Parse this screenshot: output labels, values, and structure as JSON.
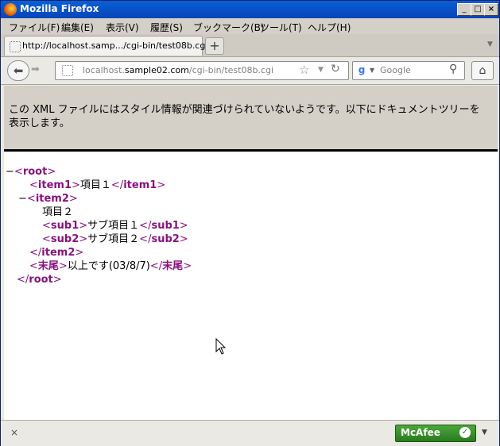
{
  "window": {
    "title": "Mozilla Firefox"
  },
  "menu": [
    "ファイル(F)",
    "編集(E)",
    "表示(V)",
    "履歴(S)",
    "ブックマーク(B)",
    "ツール(T)",
    "ヘルプ(H)"
  ],
  "tab": {
    "label": "http://localhost.samp.../cgi-bin/test08b.cgi",
    "new_label": "+"
  },
  "urlbar": {
    "host_pre": "localhost.",
    "host_domain": "sample02.com",
    "path": "/cgi-bin/test08b.cgi"
  },
  "search": {
    "engine": "g",
    "placeholder": "Google"
  },
  "notice": {
    "text": "この XML ファイルにはスタイル情報が関連づけられていないようです。以下にドキュメントツリーを表示します。"
  },
  "xml": {
    "root": "root",
    "item1": "item1",
    "item1_text": "項目１",
    "item2": "item2",
    "item2_text": "項目２",
    "sub1": "sub1",
    "sub1_text": "サブ項目１",
    "sub2": "sub2",
    "sub2_text": "サブ項目２",
    "end_tag": "末尾",
    "end_text": "以上です(03/8/7)"
  },
  "status": {
    "close": "×",
    "mcafee": "McAfee"
  }
}
